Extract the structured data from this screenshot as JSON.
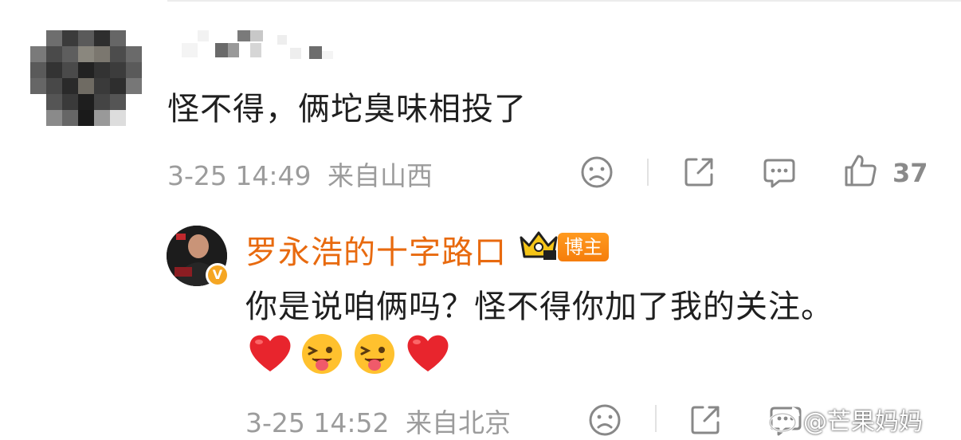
{
  "comment": {
    "text": "怪不得，俩坨臭味相投了",
    "time": "3-25 14:49",
    "location": "来自山西",
    "likes": "37",
    "icons": [
      "sad-face-icon",
      "share-icon",
      "comment-icon",
      "thumbs-up-icon"
    ]
  },
  "reply": {
    "author": "罗永浩的十字路口",
    "badge": "博主",
    "verified_mark": "V",
    "text": "你是说咱俩吗？怪不得你加了我的关注。",
    "emojis": [
      "heart",
      "tongue-wink",
      "tongue-wink",
      "heart"
    ],
    "time": "3-25 14:52",
    "location": "来自北京",
    "icons": [
      "sad-face-icon",
      "share-icon",
      "comment-icon"
    ]
  },
  "watermark": "@芒果妈妈",
  "colors": {
    "accent": "#e86a0f",
    "meta": "#9c9c9c",
    "heart": "#e8252d",
    "badge": "#f57d0b"
  }
}
